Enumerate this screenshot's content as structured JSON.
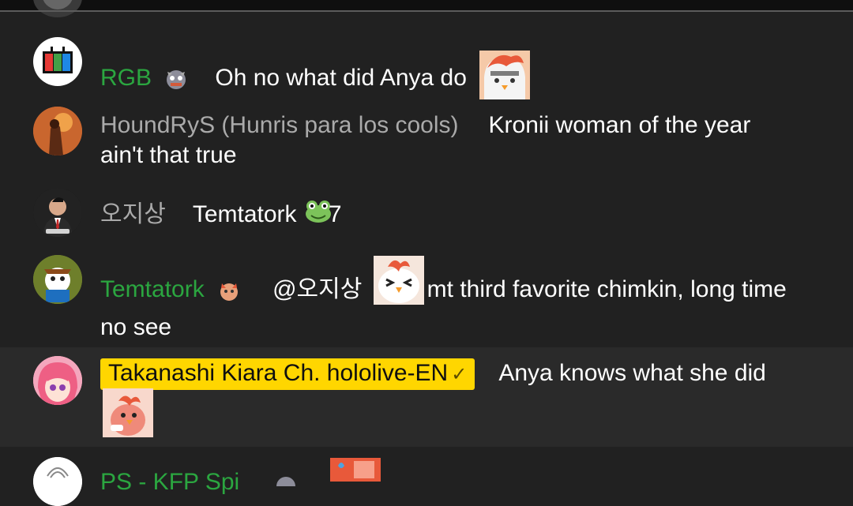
{
  "messages": [
    {
      "author": "RGB",
      "text": "Oh no what did Anya do",
      "member": true
    },
    {
      "author": "HoundRyS (Hunris para los cools)",
      "text": "Kronii woman of the year ain't that true"
    },
    {
      "author": "오지상",
      "text_before": "Temtatork",
      "text_after": "7"
    },
    {
      "author": "Temtatork",
      "mention": "@오지상",
      "text": "mt third favorite chimkin, long time no see",
      "member": true
    },
    {
      "author": "Takanashi Kiara Ch. hololive-EN",
      "verified": "✓",
      "text": "Anya knows what she did"
    },
    {
      "author": "PS - KFP Spi"
    }
  ],
  "colors": {
    "member": "#2ba640",
    "owner_badge": "#ffd600",
    "background": "#212121"
  }
}
